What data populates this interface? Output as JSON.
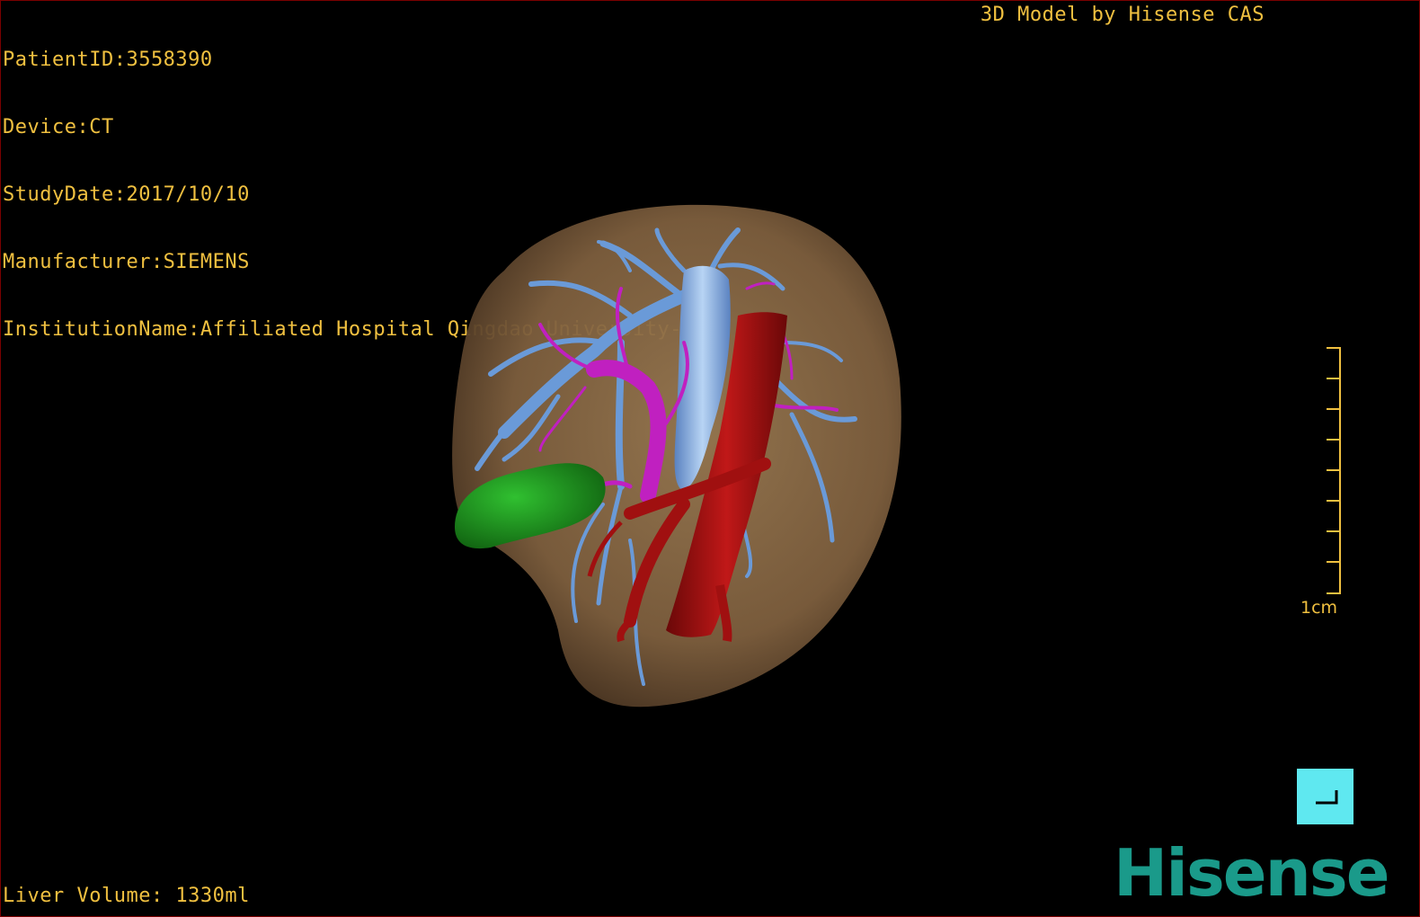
{
  "header": {
    "patient_id": "PatientID:3558390",
    "device": "Device:CT",
    "study_date": "StudyDate:2017/10/10",
    "manufacturer": "Manufacturer:SIEMENS",
    "institution": "InstitutionName:Affiliated Hospital Qingdao University-C"
  },
  "brand_caption": "3D Model by Hisense CAS",
  "liver_volume": "Liver Volume: 1330ml",
  "scale": {
    "label": "1cm"
  },
  "logo_text": "Hisense",
  "colors": {
    "overlay_text": "#f0c040",
    "liver": "#8a6a46",
    "portal_vein": "#6a9ad8",
    "hepatic_artery": "#c020c0",
    "vena_cava": "#a01010",
    "gallbladder": "#20a020",
    "orientation_button": "#5fe8f0",
    "logo": "#1a9a8a"
  },
  "icons": {
    "orientation": "corner-orientation-icon"
  }
}
